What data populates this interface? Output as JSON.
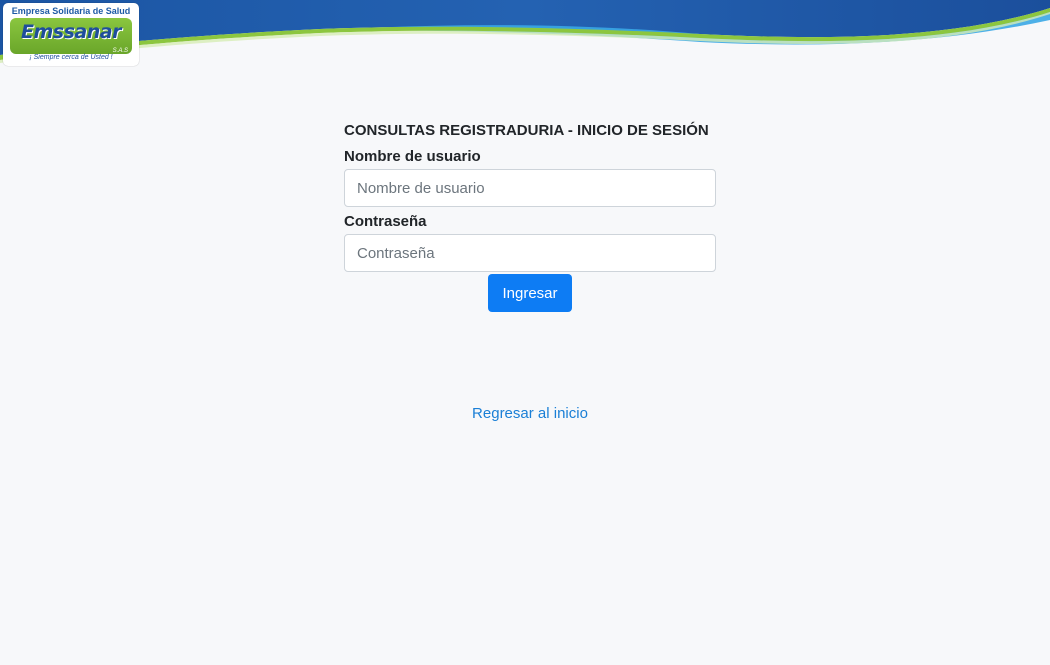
{
  "header": {
    "logo": {
      "top_text": "Empresa Solidaria de Salud",
      "wordmark": "Emssanar",
      "suffix": "S.A.S",
      "slogan": "¡ Siempre cerca de Usted !"
    },
    "colors": {
      "banner_blue": "#1f5aa8",
      "banner_light_blue": "#3aa7e6",
      "banner_green": "#8cc63f",
      "logo_green": "#7ab534"
    }
  },
  "login": {
    "title": "CONSULTAS REGISTRADURIA - INICIO DE SESIÓN",
    "username_label": "Nombre de usuario",
    "username_placeholder": "Nombre de usuario",
    "username_value": "",
    "password_label": "Contraseña",
    "password_placeholder": "Contraseña",
    "password_value": "",
    "submit_label": "Ingresar",
    "submit_color": "#0d7cf4"
  },
  "footer_link": {
    "label": "Regresar al inicio",
    "color": "#1a7fd6"
  }
}
